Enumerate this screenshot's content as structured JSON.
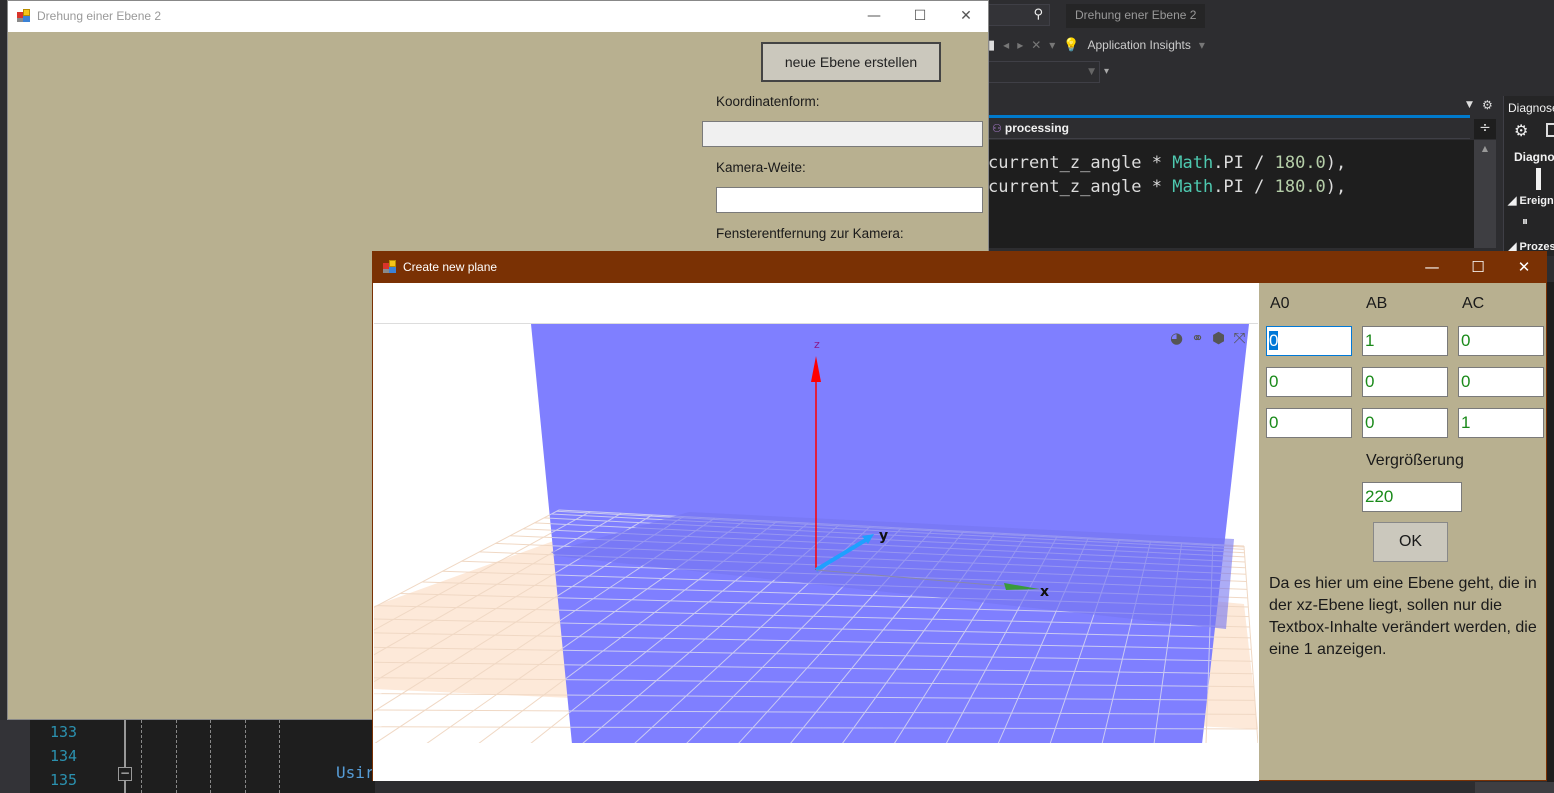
{
  "ide": {
    "window_title": "Drehung ener Ebene 2",
    "toolbar": {
      "application_insights_label": "Application Insights"
    },
    "navbar": {
      "member": "processing"
    },
    "code_lines": [
      {
        "prefix": "current_z_angle * ",
        "class": "Math",
        "rest": ".PI / ",
        "number": "180.0",
        "suffix": "),"
      },
      {
        "prefix": "current_z_angle * ",
        "class": "Math",
        "rest": ".PI / ",
        "number": "180.0",
        "suffix": "),"
      }
    ],
    "line_numbers": [
      "133",
      "134",
      "135"
    ],
    "bottom_code": "Usir",
    "diagnostics": {
      "title": "Diagnose",
      "heading": "Diagnos",
      "section_events": "Ereign",
      "section_process": "Prozes"
    }
  },
  "main_window": {
    "title": "Drehung einer Ebene 2",
    "new_plane_button": "neue Ebene erstellen",
    "coordinate_form_label": "Koordinatenform:",
    "coordinate_form_value": "",
    "camera_distance_label": "Kamera-Weite:",
    "camera_distance_value": "",
    "window_distance_label": "Fensterentfernung zur Kamera:",
    "controls": {
      "minimize": "—",
      "maximize": "☐",
      "close": "✕"
    }
  },
  "plane_dialog": {
    "title": "Create new plane",
    "controls": {
      "minimize": "—",
      "maximize": "☐",
      "close": "✕"
    },
    "columns": [
      "A0",
      "AB",
      "AC"
    ],
    "matrix": [
      [
        "0",
        "1",
        "0"
      ],
      [
        "0",
        "0",
        "0"
      ],
      [
        "0",
        "0",
        "1"
      ]
    ],
    "zoom_label": "Vergrößerung",
    "zoom_value": "220",
    "ok_button": "OK",
    "info_text": "Da es hier um eine Ebene geht, die in der xz-Ebene liegt, sollen nur die Textbox-Inhalte verändert werden, die eine 1 anzeigen.",
    "viewer": {
      "tools": [
        "rotate-icon",
        "link-icon",
        "cube-icon",
        "fullscreen-icon"
      ],
      "axes": {
        "x": "x",
        "y": "y",
        "z": "z"
      },
      "colors": {
        "plane": "#7f7fff",
        "ground": "#fde9d9",
        "z_axis": "#ff0000",
        "y_axis": "#1ea0ff",
        "x_axis": "#3a9a3a"
      }
    }
  }
}
